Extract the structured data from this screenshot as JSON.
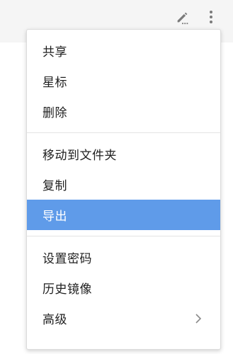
{
  "toolbar": {
    "edit_icon": "edit-pencil-icon",
    "more_icon": "more-vert-icon"
  },
  "menu": {
    "sections": [
      {
        "items": [
          {
            "label": "共享"
          },
          {
            "label": "星标"
          },
          {
            "label": "删除"
          }
        ]
      },
      {
        "items": [
          {
            "label": "移动到文件夹"
          },
          {
            "label": "复制"
          },
          {
            "label": "导出",
            "highlighted": true
          }
        ]
      },
      {
        "items": [
          {
            "label": "设置密码"
          },
          {
            "label": "历史镜像"
          },
          {
            "label": "高级",
            "has_submenu": true
          }
        ]
      }
    ],
    "highlight_color": "#5f9be9",
    "submenu_icon": "chevron-right-icon"
  }
}
